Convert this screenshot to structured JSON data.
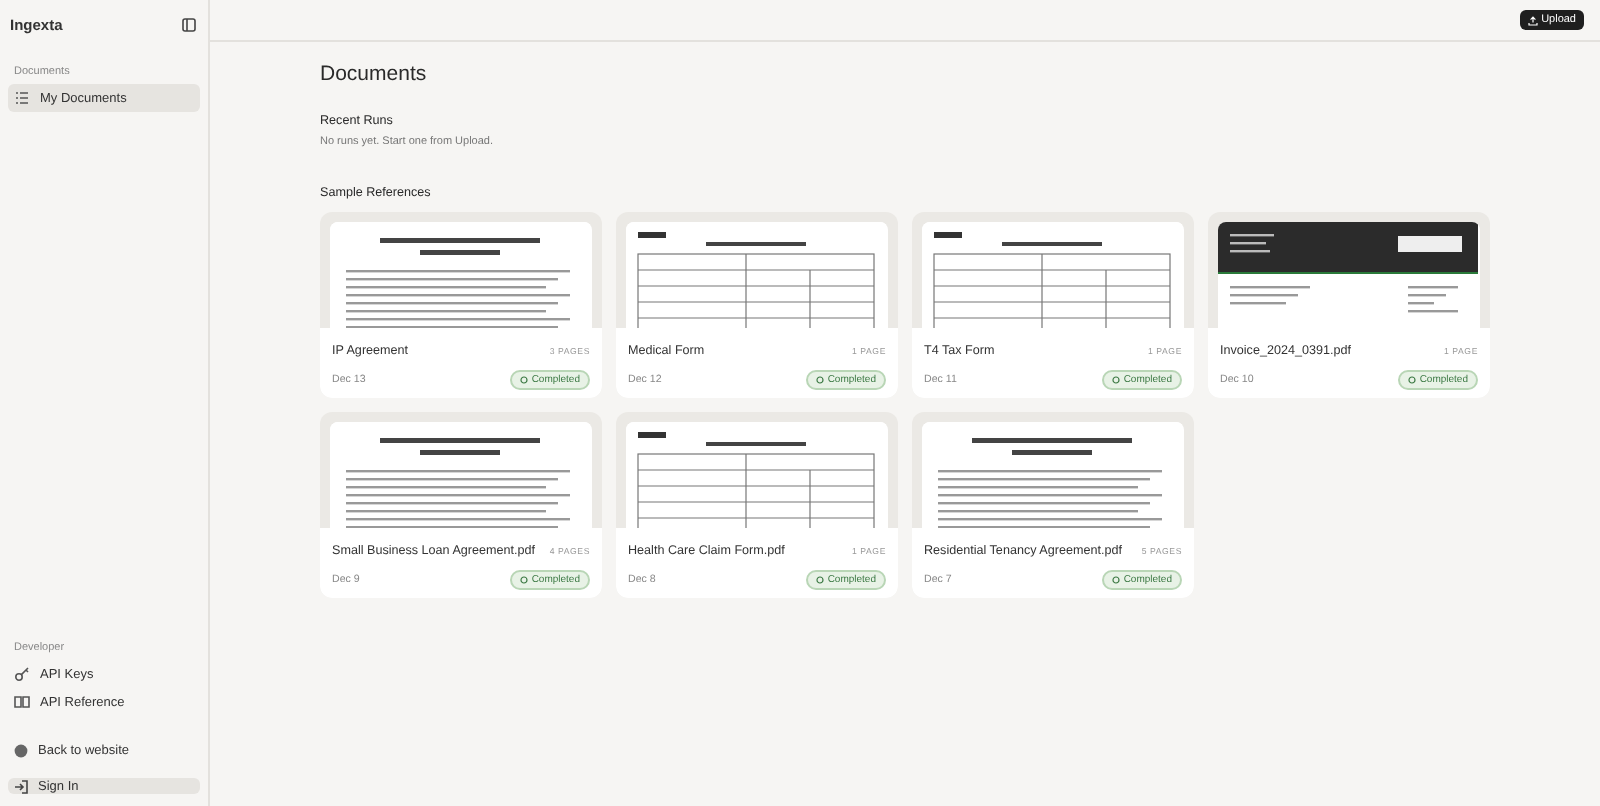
{
  "sidebar": {
    "brand": "Ingexta",
    "sections": [
      {
        "heading": "Documents",
        "items": [
          {
            "label": "My Documents",
            "kind": "list",
            "selected": true
          }
        ]
      },
      {
        "heading": "Developer",
        "items": [
          {
            "label": "API Keys",
            "kind": "key",
            "selected": false
          },
          {
            "label": "API Reference",
            "kind": "book",
            "selected": false
          }
        ]
      }
    ],
    "back_link": {
      "label": "Back to website"
    },
    "sign_in_button": {
      "label": "Sign In"
    }
  },
  "top_bar": {
    "upload_button": {
      "label": "Upload"
    }
  },
  "page_title": "Documents",
  "recent_runs": {
    "heading": "Recent Runs",
    "empty_message": "No runs yet. Start one from Upload."
  },
  "sample_references": {
    "heading": "Sample References",
    "documents": [
      {
        "name": "IP Agreement",
        "pages": "3 PAGES",
        "date": "Dec 13",
        "status": "Completed",
        "kind": "contract"
      },
      {
        "name": "Medical Form",
        "pages": "1 PAGE",
        "date": "Dec 12",
        "status": "Completed",
        "kind": "form"
      },
      {
        "name": "T4 Tax Form",
        "pages": "1 PAGE",
        "date": "Dec 11",
        "status": "Completed",
        "kind": "form"
      },
      {
        "name": "Invoice_2024_0391.pdf",
        "pages": "1 PAGE",
        "date": "Dec 10",
        "status": "Completed",
        "kind": "invoice"
      },
      {
        "name": "Small Business Loan Agreement.pdf",
        "pages": "4 PAGES",
        "date": "Dec 9",
        "status": "Completed",
        "kind": "contract"
      },
      {
        "name": "Health Care Claim Form.pdf",
        "pages": "1 PAGE",
        "date": "Dec 8",
        "status": "Completed",
        "kind": "form"
      },
      {
        "name": "Residential Tenancy Agreement.pdf",
        "pages": "5 PAGES",
        "date": "Dec 7",
        "status": "Completed",
        "kind": "contract"
      }
    ]
  }
}
